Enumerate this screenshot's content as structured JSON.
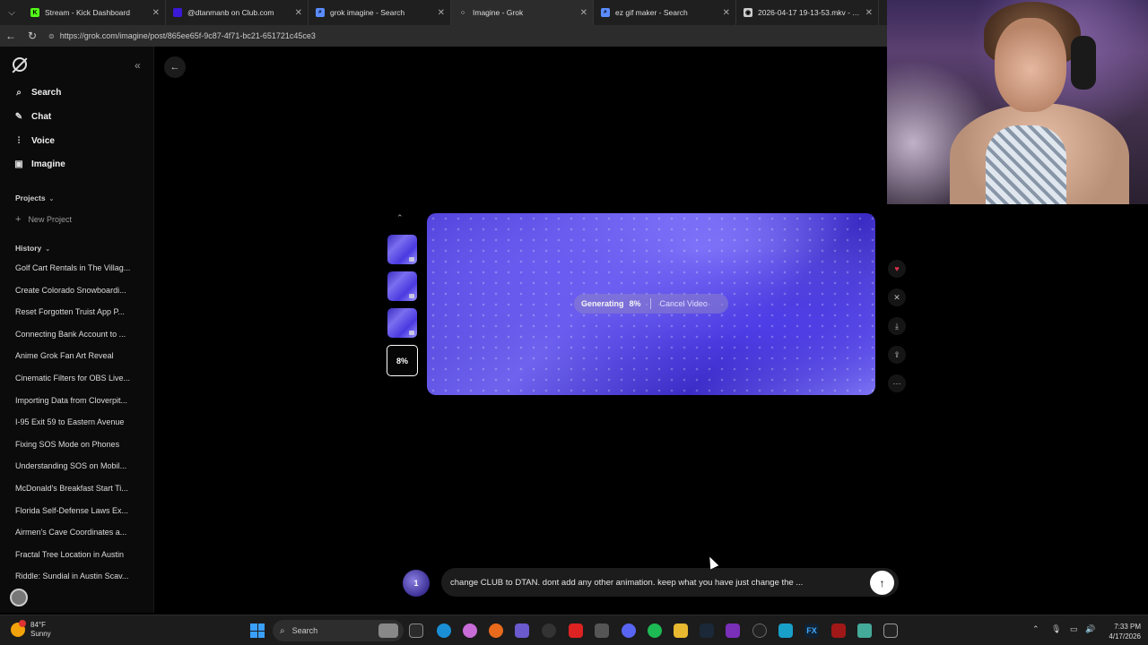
{
  "browser": {
    "tabs": [
      {
        "label": "Stream - Kick Dashboard",
        "color": "#53fc18",
        "glyph": "K",
        "active": false
      },
      {
        "label": "@dtanmanb on Club.com",
        "color": "#3a1ad6",
        "glyph": "",
        "active": false
      },
      {
        "label": "grok imagine - Search",
        "color": "#5a8cff",
        "glyph": "⌕",
        "active": false
      },
      {
        "label": "Imagine - Grok",
        "color": "#ffffff",
        "glyph": "○",
        "active": true
      },
      {
        "label": "ez gif maker - Search",
        "color": "#5a8cff",
        "glyph": "⌕",
        "active": false
      },
      {
        "label": "2026-04-17 19-13-53.mkv - Anim...",
        "color": "#cccccc",
        "glyph": "◉",
        "active": false
      }
    ],
    "url": "https://grok.com/imagine/post/865ee65f-9c87-4f71-bc21-651721c45ce3"
  },
  "sidebar": {
    "nav": [
      {
        "label": "Search",
        "icon": "search-icon"
      },
      {
        "label": "Chat",
        "icon": "chat-icon"
      },
      {
        "label": "Voice",
        "icon": "voice-icon"
      },
      {
        "label": "Imagine",
        "icon": "imagine-icon"
      }
    ],
    "projects_label": "Projects",
    "new_project_label": "New Project",
    "history_label": "History",
    "history": [
      "Golf Cart Rentals in The Villag...",
      "Create Colorado Snowboardi...",
      "Reset Forgotten Truist App P...",
      "Connecting Bank Account to ...",
      "Anime Grok Fan Art Reveal",
      "Cinematic Filters for OBS Live...",
      "Importing Data from Cloverpit...",
      "I-95 Exit 59 to Eastern Avenue",
      "Fixing SOS Mode on Phones",
      "Understanding SOS on Mobil...",
      "McDonald's Breakfast Start Ti...",
      "Florida Self-Defense Laws Ex...",
      "Airmen's Cave Coordinates a...",
      "Fractal Tree Location in Austin",
      "Riddle: Sundial in Austin Scav..."
    ]
  },
  "main": {
    "active_thumb_label": "8%",
    "generating_label": "Generating",
    "progress_label": "8%",
    "progress_value": 0.08,
    "cancel_label": "Cancel Video",
    "prompt_avatar_label": "1",
    "prompt_text": "change CLUB to DTAN. dont add any other animation. keep what you have just change the ..."
  },
  "taskbar": {
    "temperature": "84°F",
    "condition": "Sunny",
    "search_label": "Search",
    "time": "7:33 PM",
    "date": "4/17/2026"
  }
}
